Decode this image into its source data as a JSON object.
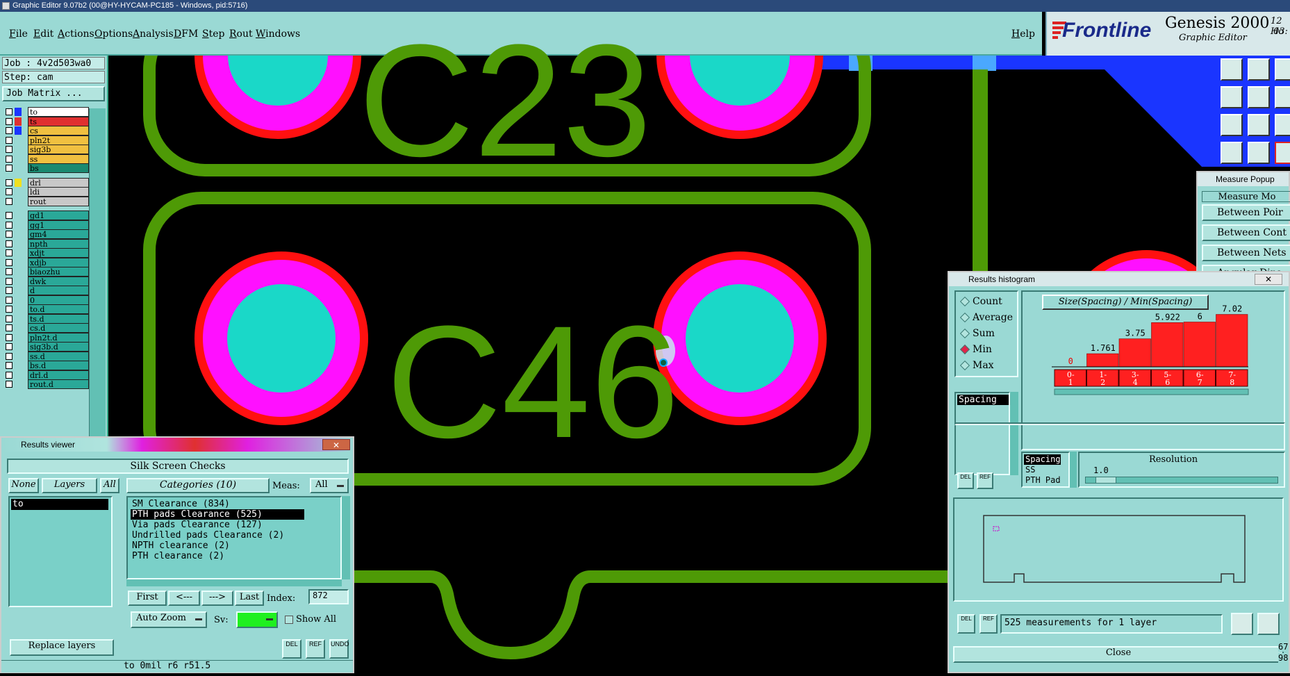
{
  "window": {
    "title": "Graphic Editor 9.07b2 (00@HY-HYCAM-PC185 - Windows, pid:5716)"
  },
  "menu": {
    "file": "File",
    "edit": "Edit",
    "actions": "Actions",
    "options": "Options",
    "analysis": "Analysis",
    "dfm": "DFM",
    "step": "Step",
    "rout": "Rout",
    "windows": "Windows",
    "help": "Help"
  },
  "brand": {
    "logo": "Frontline",
    "product": "Genesis 2000",
    "subtitle": "Graphic Editor",
    "date": "12 Ho",
    "time": "03:"
  },
  "left": {
    "job": "Job : 4v2d503wa0",
    "step": "Step: cam",
    "job_matrix": "Job Matrix ...",
    "layers": [
      {
        "name": "to",
        "color": "#1a35ff",
        "bg": "#ffffff"
      },
      {
        "name": "ts",
        "color": "#e03030",
        "bg": "#e03030"
      },
      {
        "name": "cs",
        "color": "#1a35ff",
        "bg": "#f0c040"
      },
      {
        "name": "pln2t",
        "color": "#9ad9d4",
        "bg": "#f0c040"
      },
      {
        "name": "sig3b",
        "color": "#9ad9d4",
        "bg": "#f0c040"
      },
      {
        "name": "ss",
        "color": "#9ad9d4",
        "bg": "#f0c040"
      },
      {
        "name": "bs",
        "color": "#9ad9d4",
        "bg": "#1a8a70"
      },
      {
        "name": "drl",
        "color": "#f0e020",
        "bg": "#c8c8c8"
      },
      {
        "name": "ldi",
        "color": "#9ad9d4",
        "bg": "#c8c8c8"
      },
      {
        "name": "rout",
        "color": "#9ad9d4",
        "bg": "#c8c8c8"
      },
      {
        "name": "gd1",
        "color": "#9ad9d4",
        "bg": "#2aa898"
      },
      {
        "name": "gg1",
        "color": "#9ad9d4",
        "bg": "#2aa898"
      },
      {
        "name": "gm4",
        "color": "#9ad9d4",
        "bg": "#2aa898"
      },
      {
        "name": "npth",
        "color": "#9ad9d4",
        "bg": "#2aa898"
      },
      {
        "name": "xdjt",
        "color": "#9ad9d4",
        "bg": "#2aa898"
      },
      {
        "name": "xdjb",
        "color": "#9ad9d4",
        "bg": "#2aa898"
      },
      {
        "name": "biaozhu",
        "color": "#9ad9d4",
        "bg": "#2aa898"
      },
      {
        "name": "dwk",
        "color": "#9ad9d4",
        "bg": "#2aa898"
      },
      {
        "name": "d",
        "color": "#9ad9d4",
        "bg": "#2aa898"
      },
      {
        "name": "0",
        "color": "#9ad9d4",
        "bg": "#2aa898"
      },
      {
        "name": "to.d",
        "color": "#9ad9d4",
        "bg": "#2aa898"
      },
      {
        "name": "ts.d",
        "color": "#9ad9d4",
        "bg": "#2aa898"
      },
      {
        "name": "cs.d",
        "color": "#9ad9d4",
        "bg": "#2aa898"
      },
      {
        "name": "pln2t.d",
        "color": "#9ad9d4",
        "bg": "#2aa898"
      },
      {
        "name": "sig3b.d",
        "color": "#9ad9d4",
        "bg": "#2aa898"
      },
      {
        "name": "ss.d",
        "color": "#9ad9d4",
        "bg": "#2aa898"
      },
      {
        "name": "bs.d",
        "color": "#9ad9d4",
        "bg": "#2aa898"
      },
      {
        "name": "drl.d",
        "color": "#9ad9d4",
        "bg": "#2aa898"
      },
      {
        "name": "rout.d",
        "color": "#9ad9d4",
        "bg": "#2aa898"
      }
    ]
  },
  "canvas": {
    "label_top": "C23",
    "label_main": "C46"
  },
  "results_viewer": {
    "title": "Results viewer",
    "header": "Silk Screen Checks",
    "none_btn": "None",
    "layers_btn": "Layers",
    "all_btn": "All",
    "categories_btn": "Categories (10)",
    "meas_label": "Meas:",
    "meas_value": "All",
    "layer_item": "to",
    "categories": [
      "SM Clearance (834)",
      "PTH pads Clearance (525)",
      "Via pads Clearance (127)",
      "Undrilled pads Clearance (2)",
      "NPTH clearance (2)",
      "PTH clearance (2)"
    ],
    "selected_category": 1,
    "first_btn": "First",
    "prev_btn": "<---",
    "next_btn": "--->",
    "last_btn": "Last",
    "index_label": "Index:",
    "index_value": "872",
    "auto_zoom": "Auto Zoom",
    "sv_label": "Sv:",
    "show_all": "Show All",
    "replace_layers": "Replace layers",
    "del": "DEL",
    "ref": "REF",
    "undo": "UNDO",
    "status": "to 0mil  r6  r51.5"
  },
  "histogram": {
    "title": "Results histogram",
    "radios": [
      {
        "label": "Count",
        "on": false
      },
      {
        "label": "Average",
        "on": false
      },
      {
        "label": "Sum",
        "on": false
      },
      {
        "label": "Min",
        "on": true
      },
      {
        "label": "Max",
        "on": false
      }
    ],
    "list_item": "Spacing",
    "chart_title": "Size(Spacing) / Min(Spacing)",
    "chart_data": {
      "type": "bar",
      "title": "Size(Spacing) / Min(Spacing)",
      "categories": [
        "0-1",
        "1-2",
        "3-4",
        "5-6",
        "6-7",
        "7-8"
      ],
      "values": [
        0,
        1.761,
        3.75,
        5.922,
        6,
        7.02
      ],
      "value_labels": [
        "0",
        "1.761",
        "3.75",
        "5.922",
        "6",
        "7.02"
      ],
      "ylim": [
        0,
        8
      ],
      "bar_color": "#ff2020"
    },
    "sublist": [
      "Spacing",
      "SS",
      "PTH Pad"
    ],
    "resolution_label": "Resolution",
    "resolution_value": "1.0",
    "del": "DEL",
    "ref": "REF",
    "status": "525 measurements for 1 layer",
    "close": "Close"
  },
  "measure_popup": {
    "title": "Measure Popup",
    "mode_label": "Measure Mo",
    "options": [
      "Between Poir",
      "Between Cont",
      "Between Nets",
      "Angular Dina"
    ]
  },
  "edge_numbers": {
    "a": "67",
    "b": "98"
  }
}
